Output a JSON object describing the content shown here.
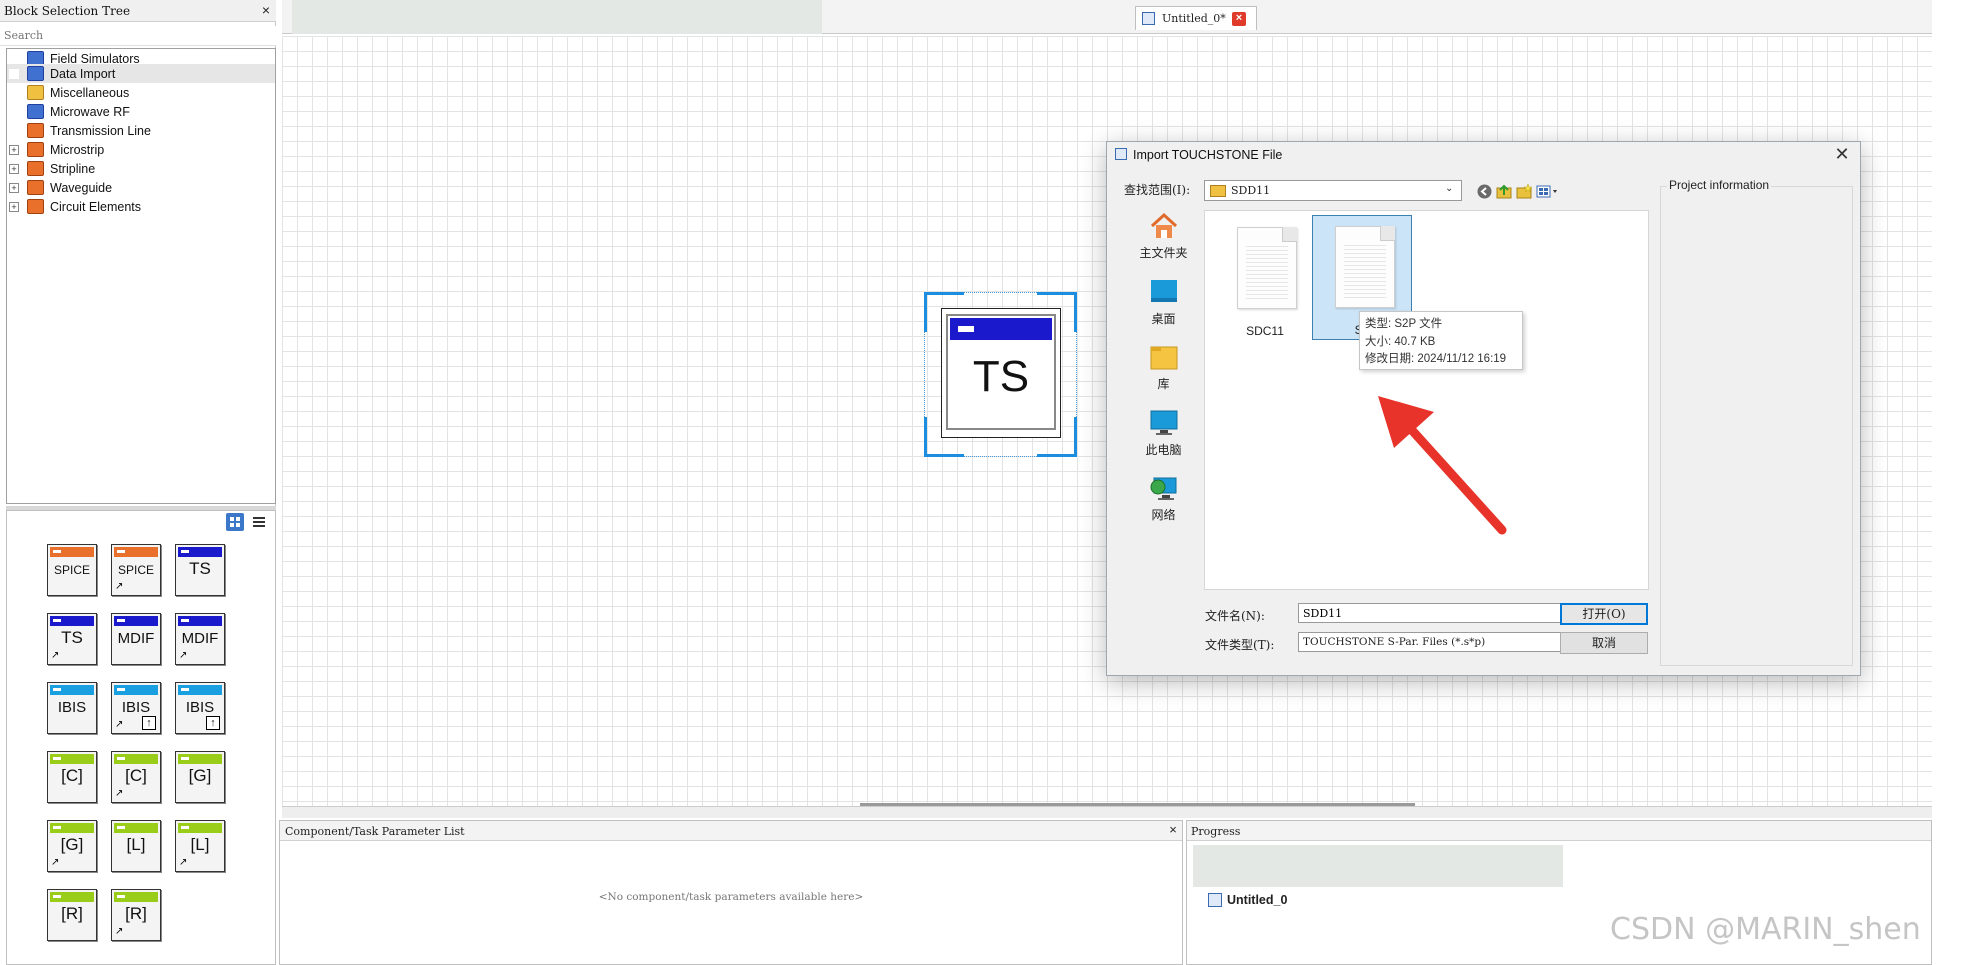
{
  "block_tree": {
    "title": "Block Selection Tree",
    "close": "×",
    "search_placeholder": "Search",
    "items": [
      {
        "label": "Field Simulators",
        "expander": ""
      },
      {
        "label": "Data Import",
        "expander": ""
      },
      {
        "label": "Miscellaneous",
        "expander": ""
      },
      {
        "label": "Microwave RF",
        "expander": ""
      },
      {
        "label": "Transmission Line",
        "expander": ""
      },
      {
        "label": "Microstrip",
        "expander": "+"
      },
      {
        "label": "Stripline",
        "expander": "+"
      },
      {
        "label": "Waveguide",
        "expander": "+"
      },
      {
        "label": "Circuit Elements",
        "expander": "+"
      }
    ]
  },
  "palette": {
    "blocks": [
      "SPICE",
      "SPICE",
      "TS",
      "TS",
      "MDIF",
      "MDIF",
      "IBIS",
      "IBIS",
      "IBIS",
      "[C]",
      "[C]",
      "[G]",
      "[G]",
      "[L]",
      "[L]",
      "[R]",
      "[R]"
    ]
  },
  "tabs": {
    "doc_tab": "Untitled_0*",
    "close": "×"
  },
  "canvas": {
    "ts_label": "TS"
  },
  "dialog": {
    "title": "Import TOUCHSTONE File",
    "close": "✕",
    "look_in_label": "查找范围(I):",
    "look_in_value": "SDD11",
    "places": [
      "主文件夹",
      "桌面",
      "库",
      "此电脑",
      "网络"
    ],
    "files": [
      {
        "name": "SDC11"
      },
      {
        "name": "SD"
      }
    ],
    "tooltip": {
      "type": "类型: S2P 文件",
      "size": "大小: 40.7 KB",
      "modified": "修改日期: 2024/11/12 16:19"
    },
    "filename_label": "文件名(N):",
    "filename_value": "SDD11",
    "filetype_label": "文件类型(T):",
    "filetype_value": "TOUCHSTONE S-Par. Files (*.s*p)",
    "open_button": "打开(O)",
    "cancel_button": "取消",
    "project_info_label": "Project information"
  },
  "param_panel": {
    "title": "Component/Task Parameter List",
    "close": "×",
    "empty_text": "<No component/task parameters available here>"
  },
  "progress_panel": {
    "title": "Progress",
    "item": "Untitled_0"
  },
  "watermark": "CSDN @MARIN_shen",
  "colors": {
    "accent": "#0078d7",
    "spice_bar": "#e8702a",
    "ts_bar": "#1a1acc",
    "ibis_bar": "#1aa0e0",
    "rlcg_bar": "#9acd1a",
    "arrow": "#e8332a"
  }
}
